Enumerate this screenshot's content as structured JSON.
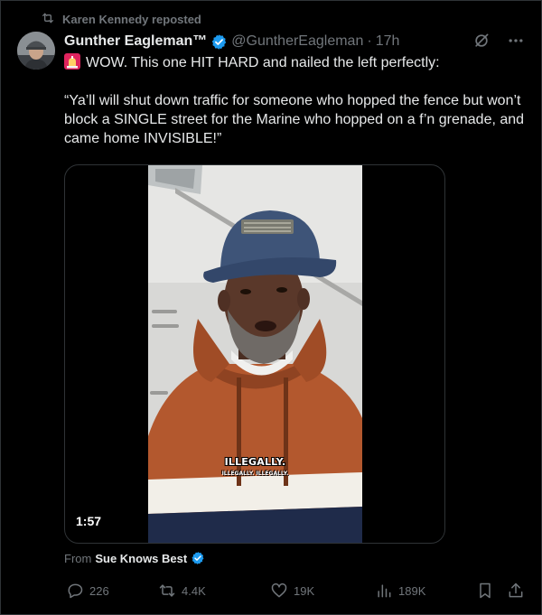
{
  "repost": {
    "text": "Karen Kennedy reposted",
    "icon": "repost-icon"
  },
  "tweet": {
    "display_name": "Gunther Eagleman™",
    "handle": "@GuntherEagleman",
    "separator": "·",
    "time": "17h",
    "verified_color": "#1d9bf0",
    "text_line1": "WOW. This one HIT HARD and nailed the left perfectly:",
    "text_quote": "“Ya’ll will shut down traffic for someone who hopped the fence but won’t block a SINGLE street for the Marine who hopped on a f’n grenade, and came home INVISIBLE!”",
    "emoji": "siren-emoji"
  },
  "media": {
    "duration": "1:57",
    "caption_main": "ILLEGALLY.",
    "caption_sub": "ILLEGALLY. ILLEGALLY."
  },
  "source": {
    "prefix": "From",
    "name": "Sue Knows Best"
  },
  "actions": {
    "replies": "226",
    "reposts": "4.4K",
    "likes": "19K",
    "views": "189K"
  },
  "colors": {
    "background": "#000000",
    "text": "#e7e9ea",
    "muted": "#71767b",
    "border": "#2f3336",
    "accent": "#1d9bf0"
  }
}
